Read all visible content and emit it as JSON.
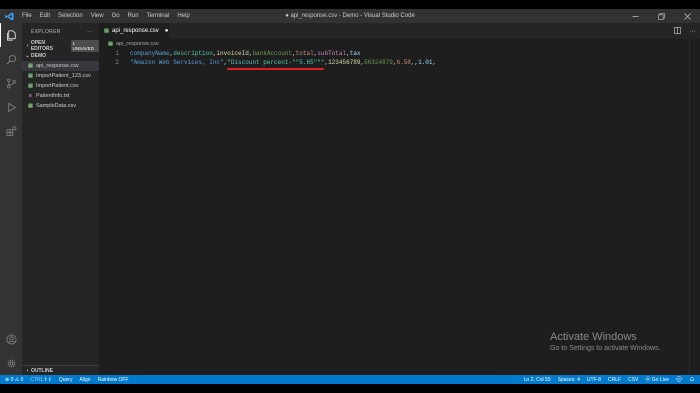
{
  "window": {
    "title": "● api_response.csv - Demo - Visual Studio Code",
    "menu": [
      "File",
      "Edit",
      "Selection",
      "View",
      "Go",
      "Run",
      "Terminal",
      "Help"
    ]
  },
  "sidebar": {
    "header": "EXPLORER",
    "more": "···",
    "open_editors_label": "OPEN EDITORS",
    "unsaved_badge": "1 UNSAVED",
    "folder_label": "DEMO",
    "files": [
      {
        "name": "api_response.csv",
        "icon": "csv-file-icon"
      },
      {
        "name": "ImportPatient_123.csv",
        "icon": "csv-file-icon"
      },
      {
        "name": "ImportPatient.csv",
        "icon": "csv-file-icon"
      },
      {
        "name": "PatientInfo.txt",
        "icon": "text-file-icon"
      },
      {
        "name": "SampleData.csv",
        "icon": "csv-file-icon"
      }
    ],
    "outline_label": "OUTLINE"
  },
  "editor": {
    "tab_label": "api_response.csv",
    "breadcrumb": "api_response.csv",
    "line_numbers": [
      "1",
      "2"
    ],
    "line1": {
      "companyName": "companyName",
      "comma1": ",",
      "description": "description",
      "comma2": ",",
      "invoiceId": "invoiceId",
      "comma3": ",",
      "bankAccount": "bankAccount",
      "comma4": ",",
      "total": "total",
      "comma5": ",",
      "subTotal": "subTotal",
      "comma6": ",",
      "tax": "tax"
    },
    "line2": {
      "company": "\"Amazon Web Services, Inc\"",
      "comma1": ",",
      "description": "\"Discount percent-\"\"5.65\"\"\"",
      "comma2": ",",
      "invoiceId": "123456789",
      "comma3": ",",
      "bankAccount": "56324879",
      "comma4": ",",
      "total": "6.58",
      "comma5": ",,",
      "tax": "1.01",
      "comma6": ","
    }
  },
  "watermark": {
    "title": "Activate Windows",
    "subtitle": "Go to Settings to activate Windows."
  },
  "status": {
    "problems": "⊗ 0 ⚠ 0",
    "extra": "CTRL⬆⬇",
    "query": "Query",
    "align": "Align",
    "rainbow": "Rainbow OFF",
    "position": "Ln 2, Col 55",
    "spaces": "Spaces: 4",
    "encoding": "UTF-8",
    "eol": "CRLF",
    "language": "CSV",
    "golive": "⦿ Go Live",
    "accent": "#007acc"
  }
}
